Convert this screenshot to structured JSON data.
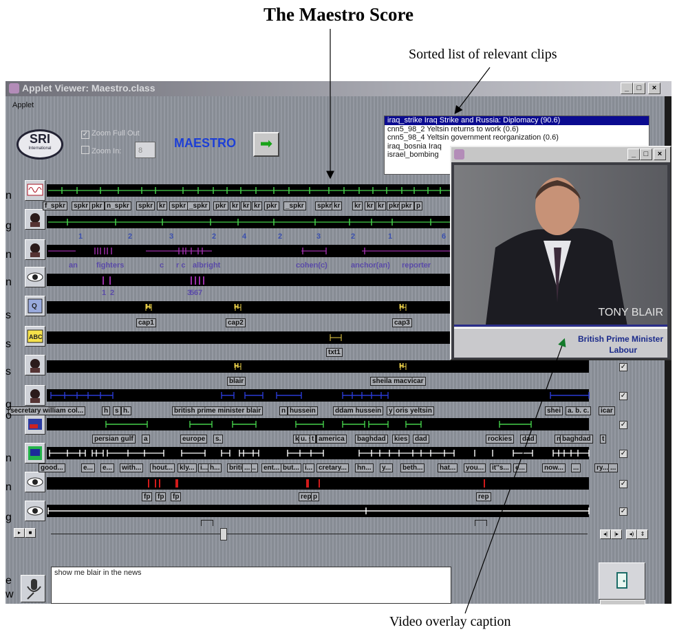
{
  "annotations": {
    "figure_title": "The Maestro Score",
    "clips_callout": "Sorted list of relevant clips",
    "caption_callout": "Video overlay caption"
  },
  "window": {
    "title": "Applet Viewer: Maestro.class",
    "menu": "Applet",
    "min_btn": "_",
    "max_btn": "□",
    "close_btn": "×"
  },
  "logo": {
    "text": "SRI",
    "sub": "International"
  },
  "zoom": {
    "full_out": "Zoom Full Out",
    "in": "Zoom In:",
    "value": "8",
    "full_out_checked": true,
    "in_checked": false
  },
  "app_name": "MAESTRO",
  "go_icon": "green-arrow-right",
  "clips": [
    "iraq_strike Iraq Strike and Russia: Diplomacy (90.6)",
    "cnn5_98_2 Yeltsin returns to work (0.6)",
    "cnn5_98_4 Yeltsin government reorganization (0.6)",
    "iraq_bosnia Iraq",
    "israel_bombing"
  ],
  "left_edge_letters": [
    "n",
    "g",
    "n",
    "n",
    "s",
    "s",
    "s",
    "g",
    "o",
    "n",
    "n",
    "g",
    "e",
    "w"
  ],
  "tracks": {
    "speaker_segments": [
      "f_spkr",
      "spkr",
      "pkr",
      "n_spkr",
      "spkr",
      "kr",
      "spkr",
      "_spkr",
      "pkr",
      "kr",
      "kr",
      "kr",
      "pkr",
      "_spkr",
      "spkr",
      "kr",
      "kr",
      "kr",
      "kr",
      "pkr",
      "pkr",
      "p"
    ],
    "speaker_ids": [
      "1",
      "2",
      "3",
      "2",
      "4",
      "2",
      "3",
      "2",
      "1",
      "6"
    ],
    "roles": [
      "an",
      "fighters",
      "c",
      "r c",
      "albright",
      "cohen(c)",
      "anchor(an)",
      "reporter"
    ],
    "face_ids": [
      "1",
      "2",
      "3",
      "5",
      "6",
      "7"
    ],
    "captions": [
      "cap1",
      "cap2",
      "cap3"
    ],
    "text_marker": "H",
    "overlay_text": [
      "txt1"
    ],
    "faces": [
      "blair",
      "sheila macvicar"
    ],
    "names": [
      "secretary william col...",
      "h",
      "s",
      "h.",
      "british prime minister blair",
      "n",
      "hussein",
      "ddam hussein",
      "y",
      "oris yeltsin",
      "shei",
      "a. b. c.",
      "icar"
    ],
    "places": [
      "persian gulf",
      "a",
      "europe",
      "s.",
      "k",
      "u. s.",
      "t",
      "america",
      "baghdad",
      "kies",
      "dad",
      "rockies",
      "dad",
      "n",
      "baghdad",
      "t"
    ],
    "words": [
      "good...",
      "e...",
      "e...",
      "with...",
      "hout...",
      "kly...",
      "i...",
      "h...",
      "british...",
      "...",
      "ent...",
      "but...",
      "i...",
      "cretary...",
      "hn...",
      "y...",
      "beth...",
      "hat...",
      "you...",
      "it''s...",
      "e...",
      "now...",
      "...",
      "ry...",
      "..."
    ],
    "events": [
      "fp",
      "fp",
      "fp",
      "rep",
      "p",
      "rep"
    ]
  },
  "video": {
    "name_overlay": "TONY BLAIR",
    "title_overlay": "British Prime Minister",
    "party_overlay": "Labour"
  },
  "query": {
    "text": "show me blair in the news"
  },
  "playback": {
    "play": "▸",
    "stop": "■",
    "rew": "◂|",
    "fwd": "|▸",
    "vol": "◂)",
    "spin": "⇕",
    "slider_position": 0.32
  }
}
